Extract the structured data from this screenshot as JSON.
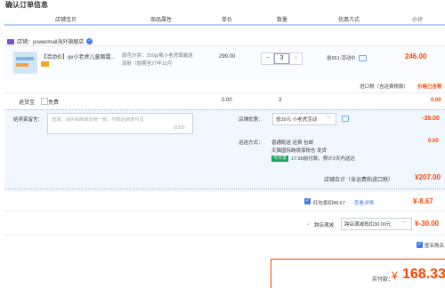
{
  "page": {
    "title": "确认订单信息"
  },
  "header": {
    "columns": [
      "店铺宝贝",
      "商品属性",
      "单价",
      "数量",
      "优惠方式",
      "小计"
    ]
  },
  "shop": {
    "name": "店铺：powermall海外旗舰店"
  },
  "item": {
    "name": "【活动价】qv小老虎儿童面霜...",
    "attr_line1": "颜色分类：250g/瓶小老虎面霜送",
    "attr_line2": "润肤（效期至27年12月",
    "price": "299.00",
    "quantity": "3",
    "promo": "省651:活动价",
    "subtotal": "246.00"
  },
  "tax": {
    "label": "进口税（含运费税款）",
    "value": "价格已含税"
  },
  "baobei": {
    "label": "退货宝",
    "free": "免费",
    "price": "0.00",
    "qty": "3",
    "subtotal": "0.00"
  },
  "message": {
    "label": "给卖家留言：",
    "placeholder": "选填，请先和商家协商一致，付款后商家可见",
    "count": "0/200"
  },
  "discount": {
    "label": "店铺优惠：",
    "selected": "省39元:小老虎活动",
    "amount": "-39.00"
  },
  "shipping": {
    "label": "运送方式：",
    "line1": "普通配送 运费 包邮",
    "line2": "天猫国际跨境保税仓 发货",
    "tag": "今日发",
    "line3": "17:30前付款，预计2天内送达",
    "amount": "0.00"
  },
  "store_total": {
    "label": "店铺合计（含运费和进口税）",
    "amount": "¥207.00"
  },
  "redpacket": {
    "label": "红包抵扣¥8.67",
    "link": "查看详情",
    "amount": "¥-8.67"
  },
  "cross_store": {
    "label": "跨店满减",
    "selected": "跨店满减抵扣30.00元",
    "amount": "¥-30.00"
  },
  "anonymous": {
    "label": "匿名购买"
  },
  "payment": {
    "label": "实付款：",
    "yen": "¥",
    "amount": "168.33"
  },
  "colors": {
    "accent": "#ff4400",
    "link": "#3c7ee7",
    "panel": "#f1f7ff"
  }
}
